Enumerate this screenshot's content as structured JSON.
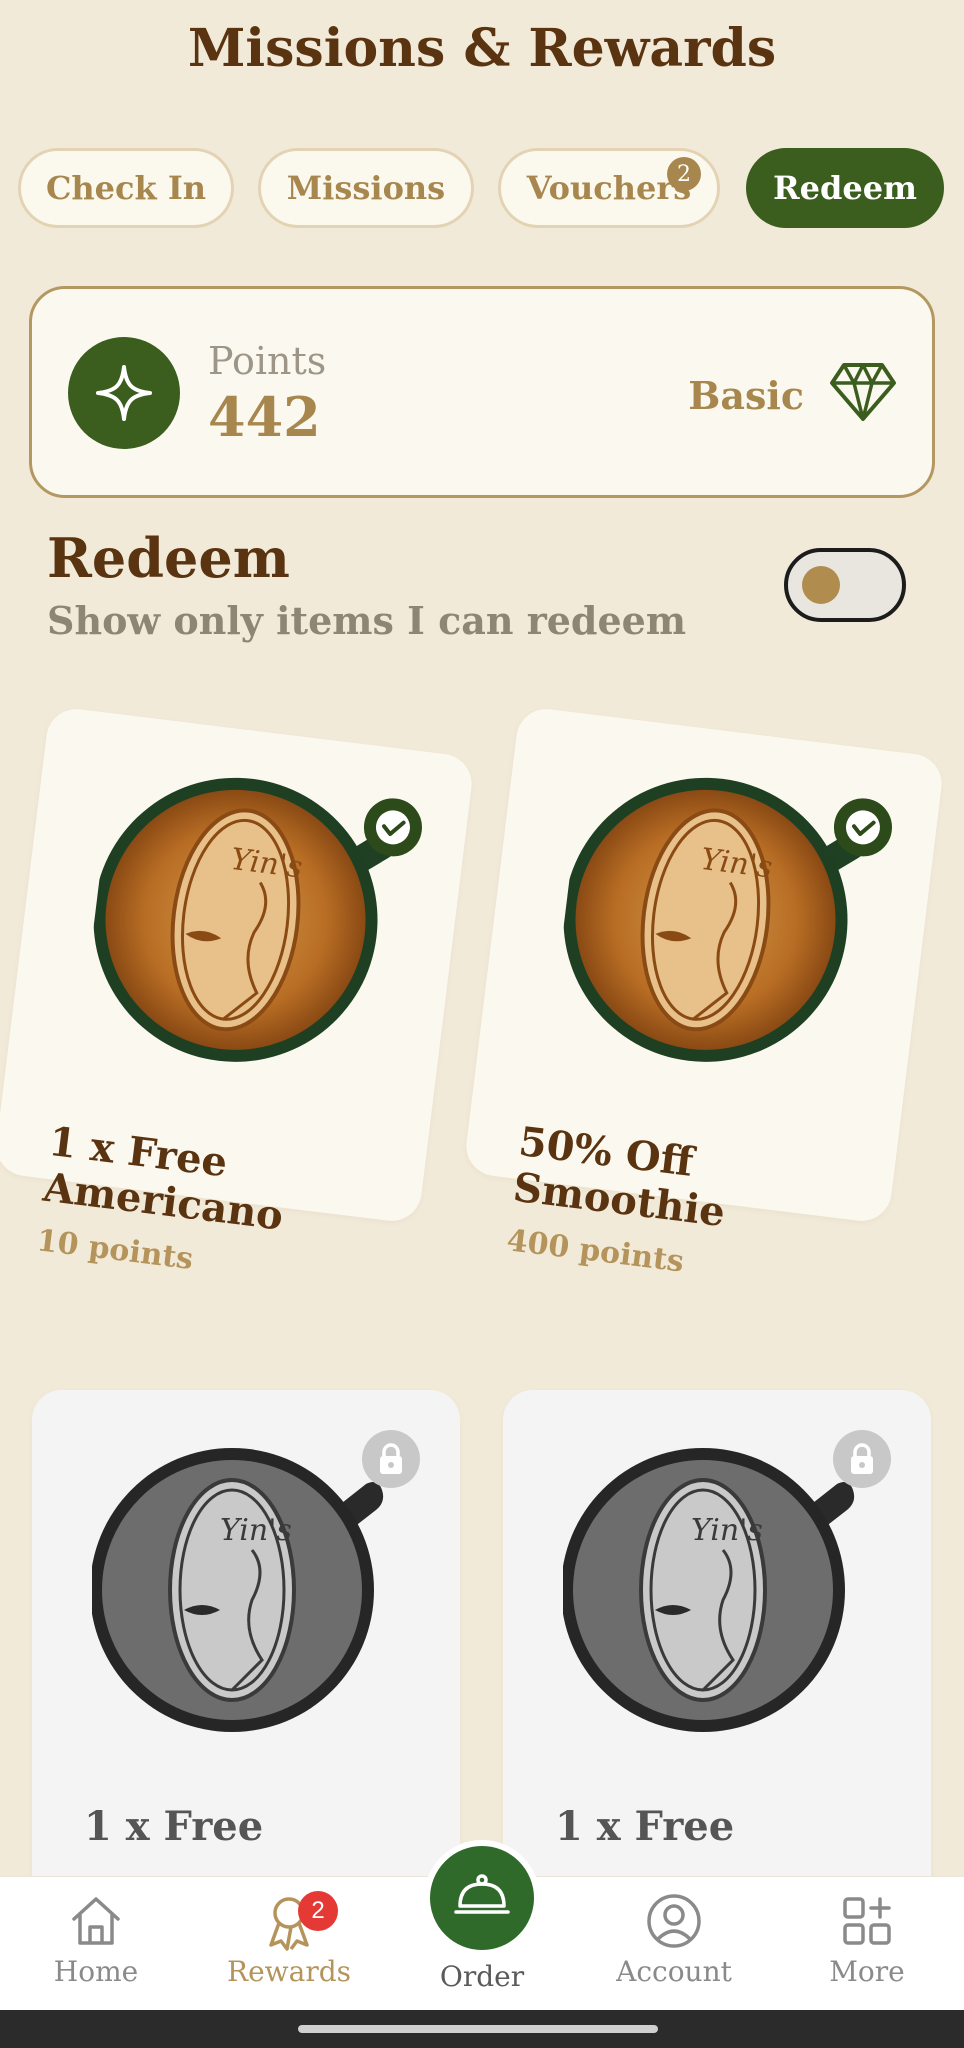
{
  "header": {
    "title": "Missions & Rewards"
  },
  "tabs": [
    {
      "label": "Check In",
      "active": false
    },
    {
      "label": "Missions",
      "active": false
    },
    {
      "label": "Vouchers",
      "active": false,
      "badge": "2"
    },
    {
      "label": "Redeem",
      "active": true
    }
  ],
  "points_card": {
    "label": "Points",
    "value": "442",
    "tier": "Basic",
    "icon": "sparkle-icon",
    "tier_icon": "diamond-icon"
  },
  "redeem": {
    "title": "Redeem",
    "filter_label": "Show only items I can redeem",
    "filter_on": false
  },
  "rewards": [
    {
      "name": "1 x Free Americano",
      "points": "10 points",
      "status": "redeemable"
    },
    {
      "name": "50% Off Smoothie",
      "points": "400 points",
      "status": "redeemable"
    },
    {
      "name": "1 x Free",
      "points": "",
      "status": "locked"
    },
    {
      "name": "1 x Free",
      "points": "",
      "status": "locked"
    }
  ],
  "bottom_nav": {
    "items": [
      {
        "label": "Home",
        "icon": "home-icon"
      },
      {
        "label": "Rewards",
        "icon": "ribbon-icon",
        "badge": "2",
        "active": true
      },
      {
        "label": "Order",
        "icon": "cloche-icon"
      },
      {
        "label": "Account",
        "icon": "user-icon"
      },
      {
        "label": "More",
        "icon": "grid-plus-icon"
      }
    ]
  },
  "colors": {
    "background": "#f2ead9",
    "brand_green": "#3b5e1f",
    "gold": "#a8874f",
    "dark_brown": "#5a3310"
  }
}
